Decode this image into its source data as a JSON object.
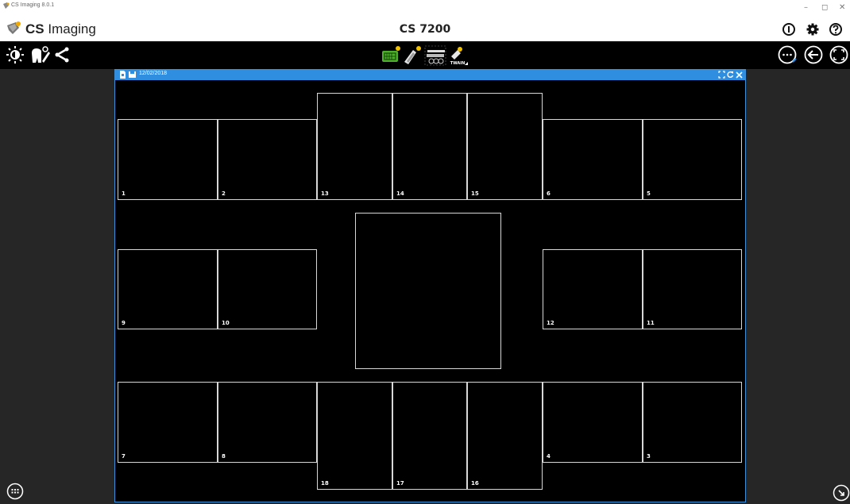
{
  "window": {
    "title": "CS Imaging 8.0.1",
    "controls": [
      "–",
      "◻",
      "✕"
    ]
  },
  "app": {
    "brand_bold": "CS",
    "brand_light": "Imaging",
    "device": "CS 7200",
    "top_icons": [
      "info-icon",
      "gear-icon",
      "help-icon"
    ]
  },
  "toolbar": {
    "left_icons": [
      "brightness-icon",
      "tooth-tool-icon",
      "share-icon"
    ],
    "center_icons": [
      "sensor-acquisition-icon",
      "intraoral-camera-icon",
      "cephalometric-icon",
      "twain-icon"
    ],
    "twain_label": "TWAIN",
    "right_icons": [
      "more-options-icon",
      "back-arrow-icon",
      "fullscreen-icon"
    ]
  },
  "xray_window": {
    "date": "12/02/2018",
    "slots": [
      {
        "label": "1"
      },
      {
        "label": "2"
      },
      {
        "label": "13"
      },
      {
        "label": "14"
      },
      {
        "label": "15"
      },
      {
        "label": "6"
      },
      {
        "label": "5"
      },
      {
        "label": "9"
      },
      {
        "label": "10"
      },
      {
        "label": ""
      },
      {
        "label": "12"
      },
      {
        "label": "11"
      },
      {
        "label": "7"
      },
      {
        "label": "8"
      },
      {
        "label": "18"
      },
      {
        "label": "17"
      },
      {
        "label": "16"
      },
      {
        "label": "4"
      },
      {
        "label": "3"
      }
    ]
  },
  "colors": {
    "accent": "#2f8ee0",
    "background": "#262626",
    "slot_border": "#d8d8d8",
    "sensor_green": "#4caf2a"
  }
}
